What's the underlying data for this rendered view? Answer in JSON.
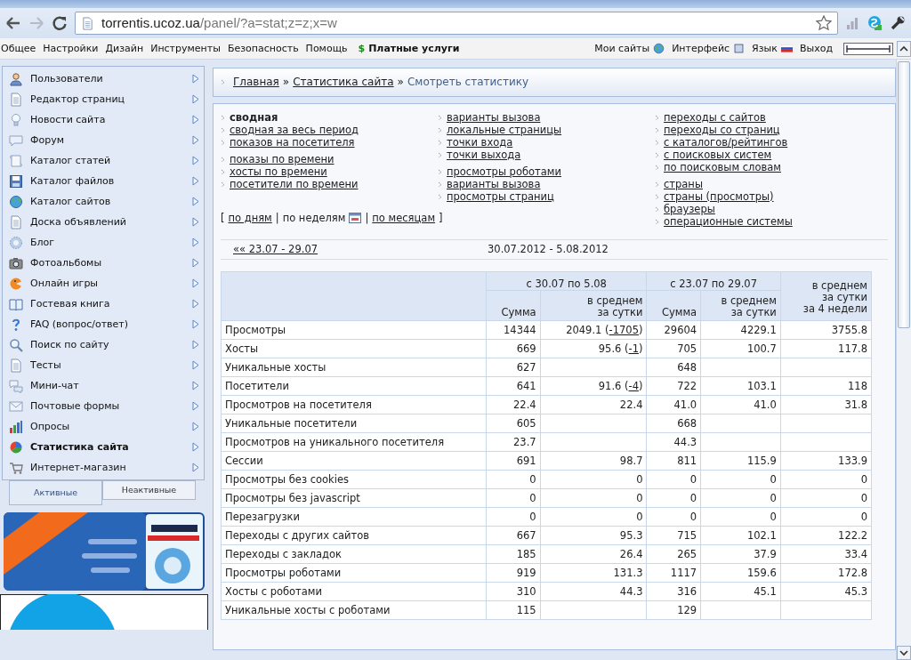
{
  "browser": {
    "url_host": "torrentis.ucoz.ua",
    "url_path": "/panel/?a=stat;z=z;x=w"
  },
  "menu": {
    "items": [
      "Общее",
      "Настройки",
      "Дизайн",
      "Инструменты",
      "Безопасность",
      "Помощь"
    ],
    "paid_icon": "$",
    "paid": "Платные услуги",
    "right": [
      {
        "label": "Мои сайты",
        "kind": "globe"
      },
      {
        "label": "Интерфейс",
        "kind": "square"
      },
      {
        "label": "Язык",
        "kind": "flag"
      },
      {
        "label": "Выход",
        "kind": "plain"
      }
    ]
  },
  "sidebar": {
    "items": [
      {
        "label": "Пользователи",
        "kind": "user",
        "selected": false
      },
      {
        "label": "Редактор страниц",
        "kind": "page",
        "selected": false
      },
      {
        "label": "Новости сайта",
        "kind": "bulb",
        "selected": false
      },
      {
        "label": "Форум",
        "kind": "bubble",
        "selected": false
      },
      {
        "label": "Каталог статей",
        "kind": "scroll",
        "selected": false
      },
      {
        "label": "Каталог файлов",
        "kind": "disk",
        "selected": false
      },
      {
        "label": "Каталог сайтов",
        "kind": "globe",
        "selected": false
      },
      {
        "label": "Доска объявлений",
        "kind": "page",
        "selected": false
      },
      {
        "label": "Блог",
        "kind": "gear",
        "selected": false
      },
      {
        "label": "Фотоальбомы",
        "kind": "camera",
        "selected": false
      },
      {
        "label": "Онлайн игры",
        "kind": "ball",
        "selected": false
      },
      {
        "label": "Гостевая книга",
        "kind": "book",
        "selected": false
      },
      {
        "label": "FAQ (вопрос/ответ)",
        "kind": "question",
        "selected": false
      },
      {
        "label": "Поиск по сайту",
        "kind": "search",
        "selected": false
      },
      {
        "label": "Тесты",
        "kind": "page",
        "selected": false
      },
      {
        "label": "Мини-чат",
        "kind": "chat",
        "selected": false
      },
      {
        "label": "Почтовые формы",
        "kind": "mail",
        "selected": false
      },
      {
        "label": "Опросы",
        "kind": "bars",
        "selected": false
      },
      {
        "label": "Статистика сайта",
        "kind": "pie",
        "selected": true
      },
      {
        "label": "Интернет-магазин",
        "kind": "cart",
        "selected": false
      }
    ],
    "tabs": [
      {
        "label": "Активные",
        "selected": true
      },
      {
        "label": "Неактивные",
        "selected": false
      }
    ]
  },
  "breadcrumb": [
    {
      "label": "Главная",
      "kind": "link"
    },
    {
      "label": "»",
      "kind": "sep"
    },
    {
      "label": "Статистика сайта",
      "kind": "link"
    },
    {
      "label": "»",
      "kind": "sep"
    },
    {
      "label": "Смотреть статистику",
      "kind": "current"
    }
  ],
  "report_links": [
    [
      [
        {
          "label": "сводная",
          "selected": true
        },
        {
          "label": "сводная за весь период",
          "selected": false
        },
        {
          "label": "показов на посетителя",
          "selected": false
        }
      ],
      [
        {
          "label": "показы по времени",
          "selected": false
        },
        {
          "label": "хосты по времени",
          "selected": false
        },
        {
          "label": "посетители по времени",
          "selected": false
        }
      ]
    ],
    [
      [
        {
          "label": "варианты вызова",
          "selected": false
        },
        {
          "label": "локальные страницы",
          "selected": false
        },
        {
          "label": "точки входа",
          "selected": false
        },
        {
          "label": "точки выхода",
          "selected": false
        }
      ],
      [
        {
          "label": "просмотры роботами",
          "selected": false
        },
        {
          "label": "варианты вызова",
          "selected": false
        },
        {
          "label": "просмотры страниц",
          "selected": false
        }
      ]
    ],
    [
      [
        {
          "label": "переходы с сайтов",
          "selected": false
        },
        {
          "label": "переходы со страниц",
          "selected": false
        },
        {
          "label": "с каталогов/рейтингов",
          "selected": false
        },
        {
          "label": "с поисковых систем",
          "selected": false
        },
        {
          "label": "по поисковым словам",
          "selected": false
        }
      ],
      [
        {
          "label": "страны",
          "selected": false
        },
        {
          "label": "страны (просмотры)",
          "selected": false
        },
        {
          "label": "браузеры",
          "selected": false
        },
        {
          "label": "операционные системы",
          "selected": false
        }
      ]
    ]
  ],
  "period": {
    "open": "[",
    "close": "]",
    "separators": [
      "|",
      "|"
    ],
    "options": [
      {
        "label": "по дням",
        "selected": false
      },
      {
        "label": "по неделям",
        "selected": true
      },
      {
        "label": "по месяцам",
        "selected": false
      }
    ]
  },
  "nav": {
    "prev": "«« 23.07 - 29.07",
    "current": "30.07.2012 - 5.08.2012"
  },
  "table": {
    "groups": [
      "с 30.07 по 5.08",
      "с 23.07 по 29.07"
    ],
    "columns": [
      "Сумма",
      "в среднем\nза сутки",
      "Сумма",
      "в среднем\nза сутки",
      "в среднем\nза сутки\nза 4 недели"
    ],
    "rows": [
      {
        "label": "Просмотры",
        "cells": [
          "14344",
          {
            "before": "2049.1 (",
            "link": "-1705",
            "after": ")"
          },
          "29604",
          "4229.1",
          "3755.8"
        ]
      },
      {
        "label": "Хосты",
        "cells": [
          "669",
          {
            "before": "95.6 (",
            "link": "-1",
            "after": ")"
          },
          "705",
          "100.7",
          "117.8"
        ]
      },
      {
        "label": "Уникальные хосты",
        "cells": [
          "627",
          "",
          "648",
          "",
          ""
        ]
      },
      {
        "label": "Посетители",
        "cells": [
          "641",
          {
            "before": "91.6 (",
            "link": "-4",
            "after": ")"
          },
          "722",
          "103.1",
          "118"
        ]
      },
      {
        "label": "Просмотров на посетителя",
        "cells": [
          "22.4",
          "22.4",
          "41.0",
          "41.0",
          "31.8"
        ]
      },
      {
        "label": "Уникальные посетители",
        "cells": [
          "605",
          "",
          "668",
          "",
          ""
        ]
      },
      {
        "label": "Просмотров на уникального посетителя",
        "cells": [
          "23.7",
          "",
          "44.3",
          "",
          ""
        ]
      },
      {
        "label": "Сессии",
        "cells": [
          "691",
          "98.7",
          "811",
          "115.9",
          "133.9"
        ]
      },
      {
        "label": "Просмотры без cookies",
        "cells": [
          "0",
          "0",
          "0",
          "0",
          "0"
        ]
      },
      {
        "label": "Просмотры без javascript",
        "cells": [
          "0",
          "0",
          "0",
          "0",
          "0"
        ]
      },
      {
        "label": "Перезагрузки",
        "cells": [
          "0",
          "0",
          "0",
          "0",
          "0"
        ]
      },
      {
        "label": "Переходы с других сайтов",
        "cells": [
          "667",
          "95.3",
          "715",
          "102.1",
          "122.2"
        ]
      },
      {
        "label": "Переходы с закладок",
        "cells": [
          "185",
          "26.4",
          "265",
          "37.9",
          "33.4"
        ]
      },
      {
        "label": "Просмотры роботами",
        "cells": [
          "919",
          "131.3",
          "1117",
          "159.6",
          "172.8"
        ]
      },
      {
        "label": "Хосты с роботами",
        "cells": [
          "310",
          "44.3",
          "316",
          "45.1",
          "45.3"
        ]
      },
      {
        "label": "Уникальные хосты с роботами",
        "cells": [
          "115",
          "",
          "129",
          "",
          ""
        ]
      }
    ]
  }
}
